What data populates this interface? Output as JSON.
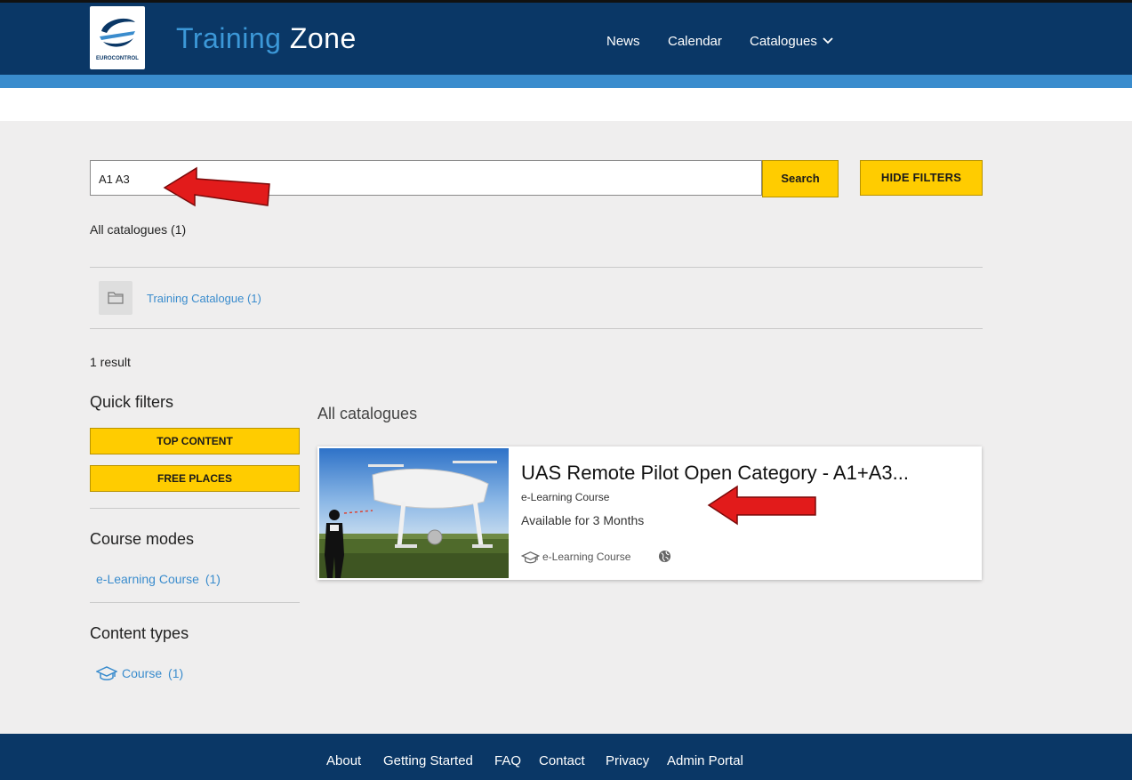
{
  "header": {
    "logo_text": "EUROCONTROL",
    "brand_part1": "Training",
    "brand_part2": "Zone",
    "nav": {
      "news": "News",
      "calendar": "Calendar",
      "catalogues": "Catalogues"
    }
  },
  "search": {
    "value": "A1 A3",
    "button_label": "Search",
    "hide_filters_label": "HIDE FILTERS"
  },
  "catalogues": {
    "all_label": "All catalogues (1)",
    "training_catalogue": "Training Catalogue (1)"
  },
  "results": {
    "count": "1 result",
    "heading": "All catalogues"
  },
  "sidebar": {
    "quick_filters_title": "Quick filters",
    "top_content": "TOP CONTENT",
    "free_places": "FREE PLACES",
    "course_modes_title": "Course modes",
    "course_mode_item": "e-Learning Course",
    "course_mode_count": "(1)",
    "content_types_title": "Content types",
    "content_type_item": "Course",
    "content_type_count": "(1)"
  },
  "card": {
    "title": "UAS Remote Pilot Open Category - A1+A3...",
    "type": "e-Learning Course",
    "availability": "Available for 3 Months",
    "meta_type": "e-Learning Course"
  },
  "footer": {
    "about": "About",
    "getting_started": "Getting Started",
    "faq": "FAQ",
    "contact": "Contact",
    "privacy": "Privacy",
    "admin_portal": "Admin Portal"
  },
  "colors": {
    "header_navy": "#0a3766",
    "accent_blue": "#3a8ccd",
    "button_yellow": "#ffcc00",
    "annotation_red": "#e21b1b"
  }
}
